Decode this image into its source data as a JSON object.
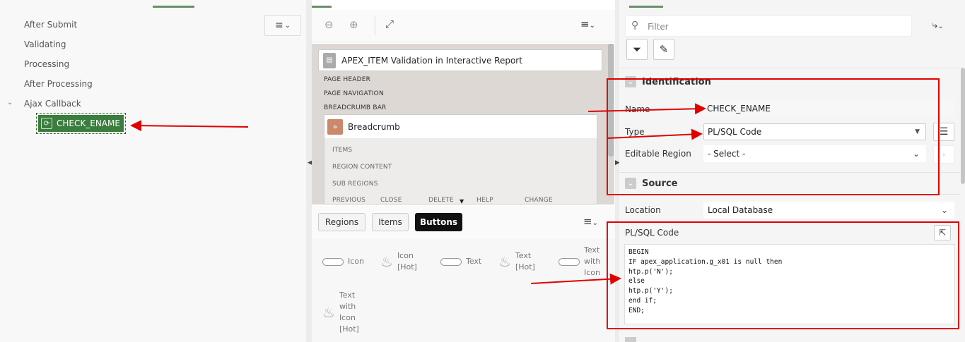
{
  "left": {
    "items": [
      "After Submit",
      "Validating",
      "Processing",
      "After Processing",
      "Ajax Callback"
    ],
    "selected_node": "CHECK_ENAME"
  },
  "layout": {
    "page_title": "APEX_ITEM Validation in Interactive Report",
    "positions": [
      "PAGE HEADER",
      "PAGE NAVIGATION",
      "BREADCRUMB BAR"
    ],
    "region_title": "Breadcrumb",
    "region_slots": [
      "ITEMS",
      "REGION CONTENT",
      "SUB REGIONS"
    ],
    "button_slots": [
      "PREVIOUS",
      "CLOSE",
      "DELETE",
      "HELP",
      "CHANGE"
    ]
  },
  "gallery": {
    "tabs": [
      "Regions",
      "Items",
      "Buttons"
    ],
    "active_tab": "Buttons",
    "items": [
      {
        "label": "Icon"
      },
      {
        "label": "Icon [Hot]"
      },
      {
        "label": "Text"
      },
      {
        "label": "Text [Hot]"
      },
      {
        "label": "Text with Icon"
      },
      {
        "label": "Text with Icon [Hot]"
      }
    ]
  },
  "props": {
    "filter_placeholder": "Filter",
    "identification_title": "Identification",
    "name_label": "Name",
    "name_value": "CHECK_ENAME",
    "type_label": "Type",
    "type_value": "PL/SQL Code",
    "editable_label": "Editable Region",
    "editable_value": "- Select -",
    "source_title": "Source",
    "location_label": "Location",
    "location_value": "Local Database",
    "code_label": "PL/SQL Code",
    "code": "BEGIN\nIF apex_application.g_x01 is null then\nhtp.p('N');\nelse\nhtp.p('Y');\nend if;\nEND;"
  },
  "colors": {
    "accent_green": "#3b7d3e",
    "annotation_red": "#e00000"
  }
}
